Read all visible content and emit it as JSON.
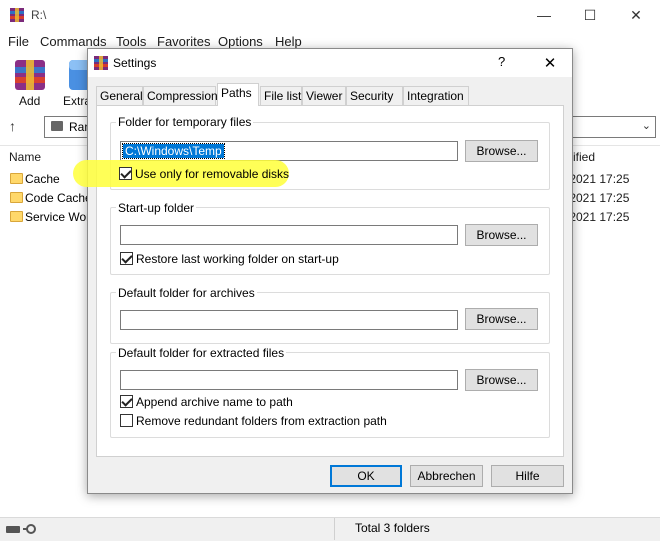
{
  "main": {
    "title": "R:\\",
    "menu": [
      "File",
      "Commands",
      "Tools",
      "Favorites",
      "Options",
      "Help"
    ],
    "toolbar": {
      "add_label": "Add",
      "extract_label": "Extra"
    },
    "address_partial": "Ran",
    "columns": {
      "name": "Name",
      "modified": "ified"
    },
    "files": [
      {
        "name": "Cache",
        "modified": ".2021 17:25"
      },
      {
        "name": "Code Cache",
        "modified": ".2021 17:25"
      },
      {
        "name": "Service Wor",
        "modified": ".2021 17:25"
      }
    ],
    "status": "Total 3 folders"
  },
  "dialog": {
    "title": "Settings",
    "help_glyph": "?",
    "tabs": [
      "General",
      "Compression",
      "Paths",
      "File list",
      "Viewer",
      "Security",
      "Integration"
    ],
    "active_tab": "Paths",
    "temp_group": {
      "label": "Folder for temporary files",
      "value": "C:\\Windows\\Temp",
      "browse": "Browse...",
      "checkbox_label": "Use only for removable disks",
      "checked": true
    },
    "startup_group": {
      "label": "Start-up folder",
      "value": "",
      "browse": "Browse...",
      "checkbox_label": "Restore last working folder on start-up",
      "checked": true
    },
    "archives_group": {
      "label": "Default folder for archives",
      "value": "",
      "browse": "Browse..."
    },
    "extract_group": {
      "label": "Default folder for extracted files",
      "value": "",
      "browse": "Browse...",
      "checkbox1_label": "Append archive name to path",
      "checkbox1_checked": true,
      "checkbox2_label": "Remove redundant folders from extraction path",
      "checkbox2_checked": false
    },
    "buttons": {
      "ok": "OK",
      "cancel": "Abbrechen",
      "help": "Hilfe"
    }
  },
  "colors": {
    "accent": "#0078d7",
    "highlight": "#ffff3a",
    "folder": "#ffd86a"
  }
}
